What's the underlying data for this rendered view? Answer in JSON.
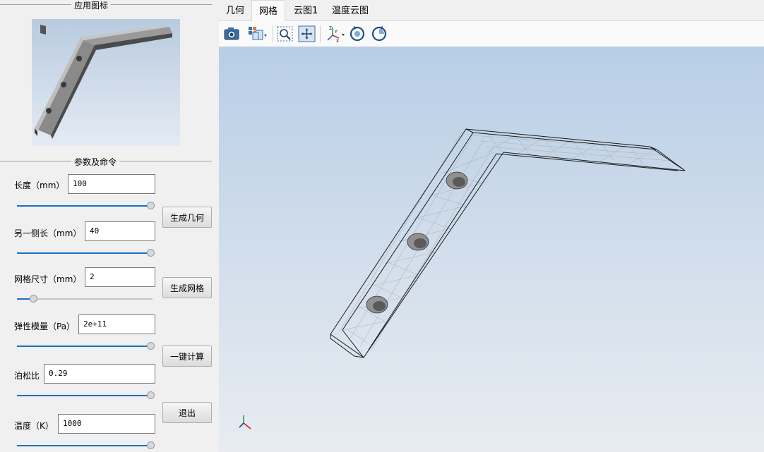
{
  "left_panel": {
    "icon_group_title": "应用图标",
    "params_group_title": "参数及命令",
    "params": [
      {
        "label": "长度（mm）",
        "value": "100",
        "slider_fraction": 1.0
      },
      {
        "label": "另一侧长（mm）",
        "value": "40",
        "slider_fraction": 1.0
      },
      {
        "label": "网格尺寸（mm）",
        "value": "2",
        "slider_fraction": 0.1
      },
      {
        "label": "弹性模量（Pa）",
        "value": "2e+11",
        "slider_fraction": 1.0
      },
      {
        "label": "泊松比",
        "value": "0.29",
        "slider_fraction": 1.0
      },
      {
        "label": "温度（K）",
        "value": "1000",
        "slider_fraction": 1.0
      }
    ],
    "buttons": {
      "gen_geometry": "生成几何",
      "gen_mesh": "生成网格",
      "compute": "一键计算",
      "exit": "退出"
    }
  },
  "tabs": [
    {
      "label": "几何",
      "active": false
    },
    {
      "label": "网格",
      "active": true
    },
    {
      "label": "云图1",
      "active": false
    },
    {
      "label": "温度云图",
      "active": false
    }
  ],
  "toolbar": [
    "camera-icon",
    "view-cube-icon",
    "zoom-fit-icon",
    "pan-icon",
    "axes-icon",
    "rotate-ccw-icon",
    "rotate-cw-icon"
  ],
  "colors": {
    "accent": "#1a6fc4",
    "viewport_top": "#b8cee6",
    "viewport_bottom": "#e8ecf1"
  }
}
